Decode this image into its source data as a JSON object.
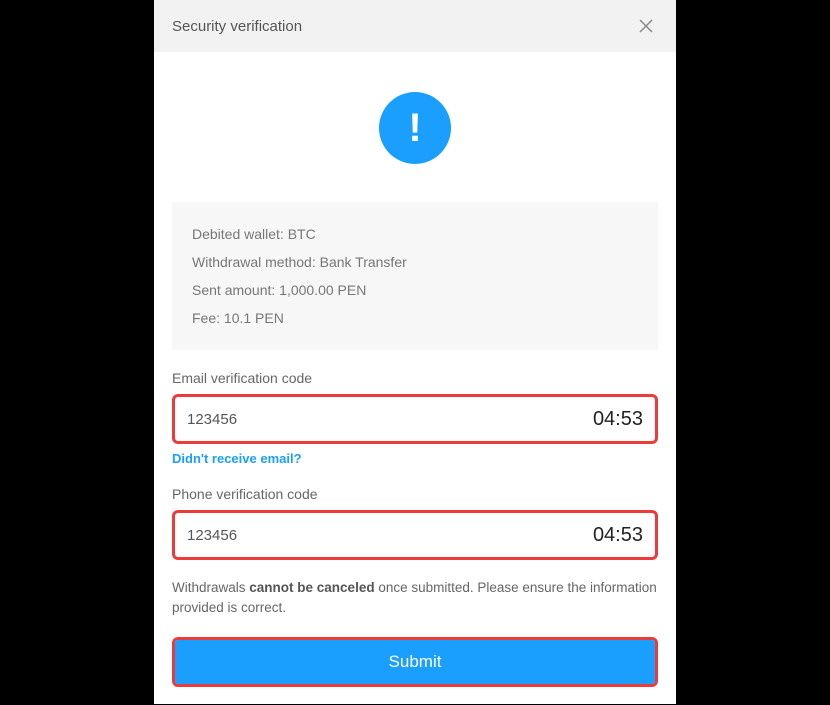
{
  "header": {
    "title": "Security verification"
  },
  "info": {
    "debited_wallet_label": "Debited wallet: ",
    "debited_wallet_value": "BTC",
    "withdrawal_method_label": "Withdrawal method: ",
    "withdrawal_method_value": "Bank Transfer",
    "sent_amount_label": "Sent amount: ",
    "sent_amount_value": "1,000.00 PEN",
    "fee_label": "Fee: ",
    "fee_value": "10.1 PEN"
  },
  "email": {
    "label": "Email verification code",
    "value": "123456",
    "timer": "04:53",
    "resend_link": "Didn't receive email?"
  },
  "phone": {
    "label": "Phone verification code",
    "value": "123456",
    "timer": "04:53"
  },
  "warning": {
    "prefix": "Withdrawals ",
    "bold": "cannot be canceled",
    "suffix": " once submitted. Please ensure the information provided is correct."
  },
  "submit": {
    "label": "Submit"
  }
}
